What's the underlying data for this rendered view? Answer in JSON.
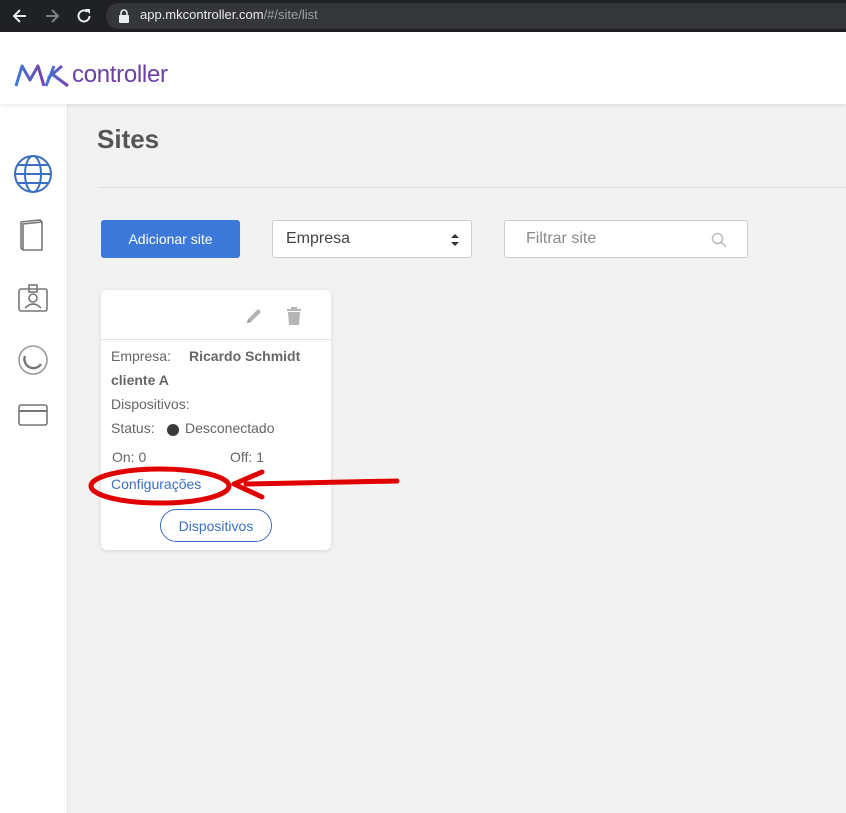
{
  "browser": {
    "url_host": "app.mkcontroller.com",
    "url_path": "/#/site/list"
  },
  "header": {
    "logo_text": "controller",
    "logo_mark": "MK",
    "brand_colors": {
      "primary": "#6b3fa6",
      "accent": "#3b78d8"
    }
  },
  "sidebar": {
    "items": [
      {
        "icon": "globe-icon",
        "active": true
      },
      {
        "icon": "book-icon",
        "active": false
      },
      {
        "icon": "id-badge-icon",
        "active": false
      },
      {
        "icon": "mikrotik-icon",
        "active": false
      },
      {
        "icon": "credit-card-icon",
        "active": false
      }
    ]
  },
  "page": {
    "title": "Sites"
  },
  "toolbar": {
    "add_label": "Adicionar site",
    "select_value": "Empresa",
    "filter_placeholder": "Filtrar site"
  },
  "site_card": {
    "empresa_label": "Empresa:",
    "empresa_value_line1": "Ricardo Schmidt",
    "empresa_value_line2": "cliente A",
    "dispositivos_label": "Dispositivos:",
    "status_label": "Status:",
    "status_value": "Desconectado",
    "status_color": "#3a3a3a",
    "on_label": "On: 0",
    "off_label": "Off: 1",
    "config_link": "Configurações",
    "devices_button": "Dispositivos"
  },
  "annotation": {
    "highlight_color": "#e00000"
  }
}
